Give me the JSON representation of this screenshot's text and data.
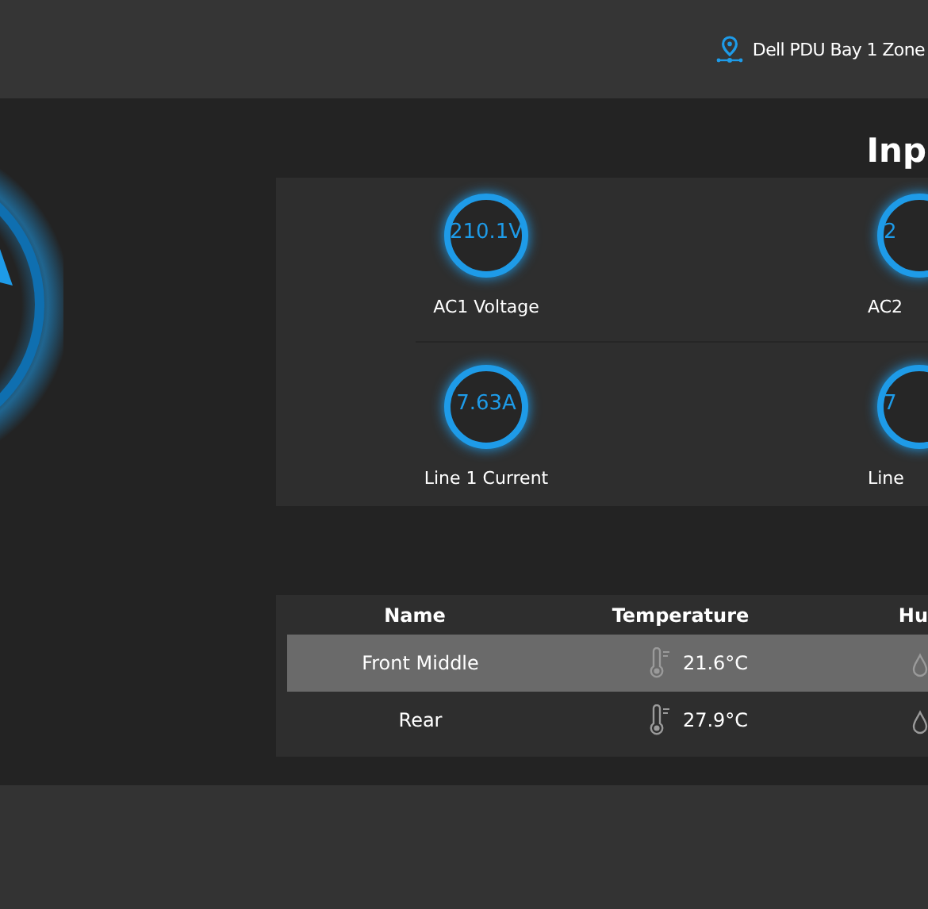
{
  "header": {
    "location": "Dell PDU Bay 1 Zone"
  },
  "section": {
    "title": "Inp"
  },
  "gauges": [
    {
      "value": "210.1V",
      "label": "AC1 Voltage"
    },
    {
      "value": "2",
      "label": "AC2"
    },
    {
      "value": "7.63A",
      "label": "Line 1 Current"
    },
    {
      "value": "7",
      "label": "Line"
    }
  ],
  "sensors": {
    "columns": [
      "Name",
      "Temperature",
      "Hu"
    ],
    "rows": [
      {
        "name": "Front Middle",
        "temperature": "21.6°C",
        "selected": true
      },
      {
        "name": "Rear",
        "temperature": "27.9°C",
        "selected": false
      }
    ]
  }
}
